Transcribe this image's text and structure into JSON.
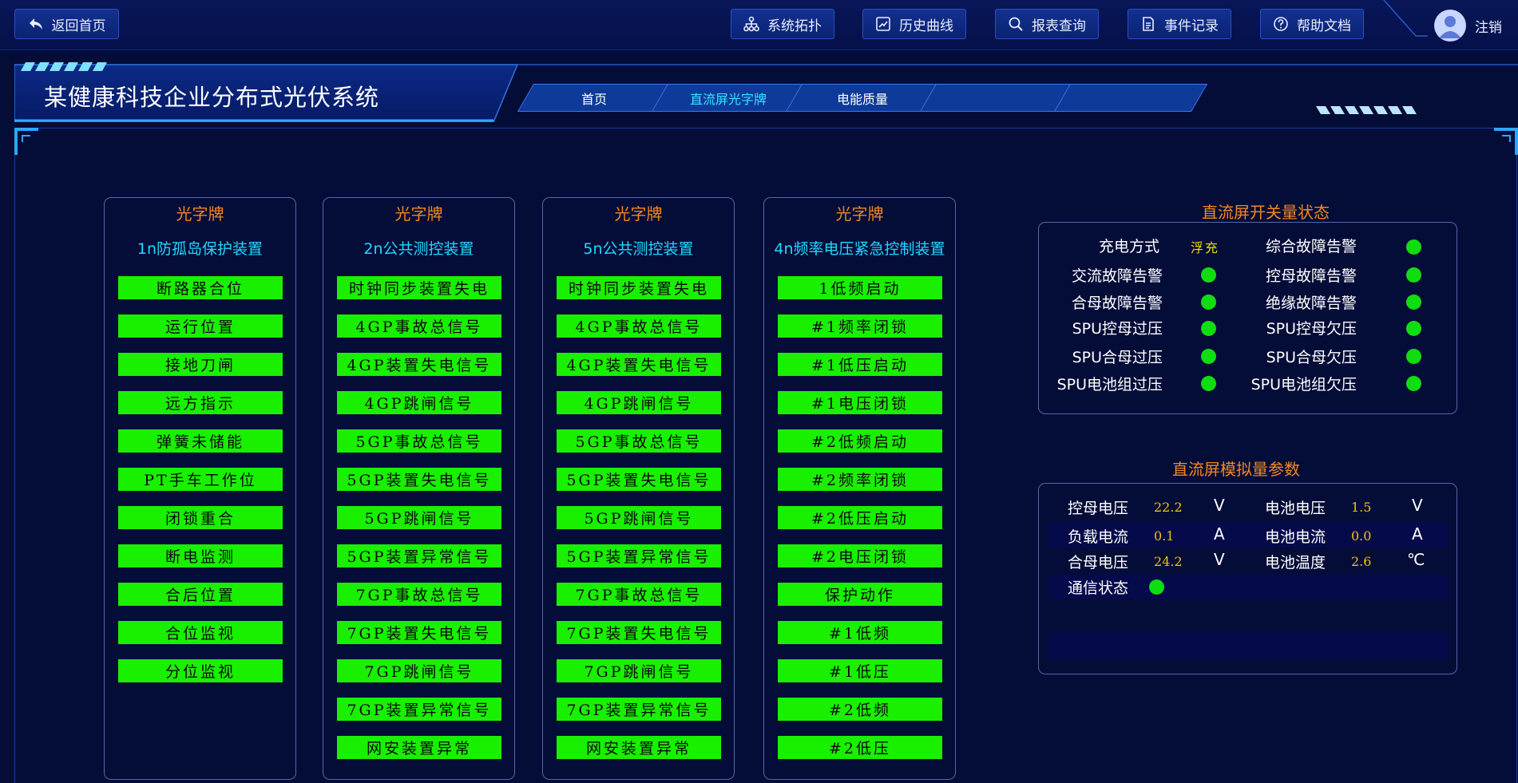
{
  "topbar": {
    "back_label": "返回首页",
    "buttons": [
      {
        "label": "系统拓扑",
        "icon": "topology-icon"
      },
      {
        "label": "历史曲线",
        "icon": "chart-icon"
      },
      {
        "label": "报表查询",
        "icon": "search-icon"
      },
      {
        "label": "事件记录",
        "icon": "document-icon"
      },
      {
        "label": "帮助文档",
        "icon": "help-icon"
      }
    ],
    "logout_label": "注销"
  },
  "header": {
    "title": "某健康科技企业分布式光伏系统",
    "tabs": [
      "首页",
      "直流屏光字牌",
      "电能质量",
      "",
      ""
    ],
    "active_tab": 1
  },
  "signal_columns": [
    {
      "title": "光字牌",
      "subtitle": "1n防孤岛保护装置",
      "items": [
        "断路器合位",
        "运行位置",
        "接地刀闸",
        "远方指示",
        "弹簧未储能",
        "PT手车工作位",
        "闭锁重合",
        "断电监测",
        "合后位置",
        "合位监视",
        "分位监视"
      ]
    },
    {
      "title": "光字牌",
      "subtitle": "2n公共测控装置",
      "items": [
        "时钟同步装置失电",
        "4GP事故总信号",
        "4GP装置失电信号",
        "4GP跳闸信号",
        "5GP事故总信号",
        "5GP装置失电信号",
        "5GP跳闸信号",
        "5GP装置异常信号",
        "7GP事故总信号",
        "7GP装置失电信号",
        "7GP跳闸信号",
        "7GP装置异常信号",
        "网安装置异常"
      ]
    },
    {
      "title": "光字牌",
      "subtitle": "5n公共测控装置",
      "items": [
        "时钟同步装置失电",
        "4GP事故总信号",
        "4GP装置失电信号",
        "4GP跳闸信号",
        "5GP事故总信号",
        "5GP装置失电信号",
        "5GP跳闸信号",
        "5GP装置异常信号",
        "7GP事故总信号",
        "7GP装置失电信号",
        "7GP跳闸信号",
        "7GP装置异常信号",
        "网安装置异常"
      ]
    },
    {
      "title": "光字牌",
      "subtitle": "4n频率电压紧急控制装置",
      "items": [
        "1低频启动",
        "#1频率闭锁",
        "#1低压启动",
        "#1电压闭锁",
        "#2低频启动",
        "#2频率闭锁",
        "#2低压启动",
        "#2电压闭锁",
        "保护动作",
        "#1低频",
        "#1低压",
        "#2低频",
        "#2低压"
      ]
    }
  ],
  "switch_panel": {
    "title": "直流屏开关量状态",
    "charge_mode_label": "充电方式",
    "charge_mode_value": "浮充",
    "left": [
      "交流故障告警",
      "合母故障告警",
      "SPU控母过压",
      "SPU合母过压",
      "SPU电池组过压"
    ],
    "right": [
      "综合故障告警",
      "控母故障告警",
      "绝缘故障告警",
      "SPU控母欠压",
      "SPU合母欠压",
      "SPU电池组欠压"
    ],
    "indicator_color": "#10dd10"
  },
  "analog_panel": {
    "title": "直流屏模拟量参数",
    "rows": [
      {
        "l_label": "控母电压",
        "l_val": "22.2",
        "l_unit": "V",
        "r_label": "电池电压",
        "r_val": "1.5",
        "r_unit": "V"
      },
      {
        "l_label": "负载电流",
        "l_val": "0.1",
        "l_unit": "A",
        "r_label": "电池电流",
        "r_val": "0.0",
        "r_unit": "A"
      },
      {
        "l_label": "合母电压",
        "l_val": "24.2",
        "l_unit": "V",
        "r_label": "电池温度",
        "r_val": "2.6",
        "r_unit": "℃"
      }
    ],
    "comm_label": "通信状态"
  },
  "colors": {
    "background": "#040c38",
    "signal_on": "#19f000",
    "title_orange": "#f08a1e",
    "subtitle_cyan": "#22d8ff"
  }
}
